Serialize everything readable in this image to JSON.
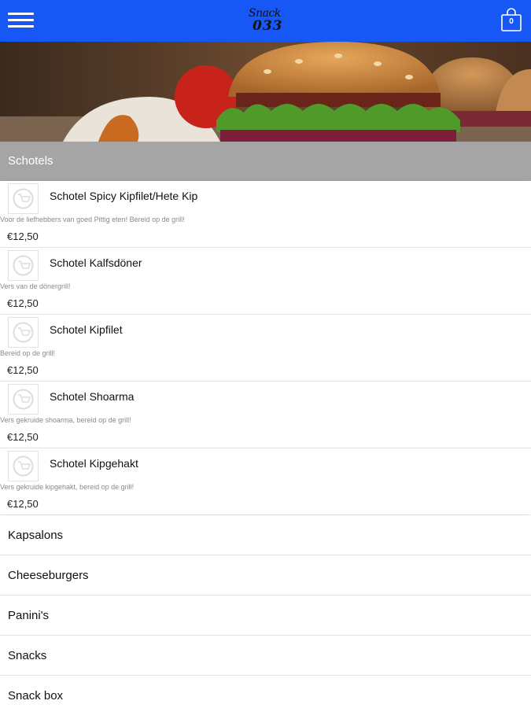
{
  "header": {
    "logo_line1": "Snack",
    "logo_line2": "033",
    "cart_count": "0",
    "brand_color": "#1757f5"
  },
  "hero": {
    "icon": "burger-banner-image"
  },
  "section": {
    "title": "Schotels",
    "items": [
      {
        "name": "Schotel Spicy Kipfilet/Hete Kip",
        "description": "Voor de liefhebbers van goed Pittig eten! Bereid op de grill!",
        "price": "€12,50"
      },
      {
        "name": "Schotel Kalfsdöner",
        "description": "Vers van de dönergrill!",
        "price": "€12,50"
      },
      {
        "name": "Schotel Kipfilet",
        "description": "Bereid op de grill!",
        "price": "€12,50"
      },
      {
        "name": "Schotel Shoarma",
        "description": "Vers gekruide shoarma, bereid op de grill!",
        "price": "€12,50"
      },
      {
        "name": "Schotel Kipgehakt",
        "description": "Vers gekruide kipgehakt, bereid op de grill!",
        "price": "€12,50"
      }
    ]
  },
  "categories": [
    {
      "label": "Kapsalons"
    },
    {
      "label": "Cheeseburgers"
    },
    {
      "label": "Panini's"
    },
    {
      "label": "Snacks"
    },
    {
      "label": "Snack box"
    }
  ]
}
